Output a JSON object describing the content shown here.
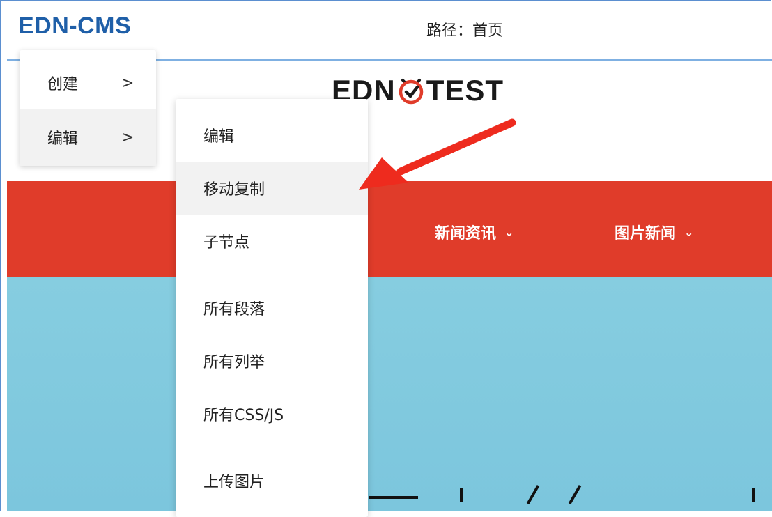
{
  "app": {
    "brand": "EDN-CMS",
    "path": "路径：首页"
  },
  "site": {
    "logo_left": "EDN",
    "logo_right": "TEST",
    "nav": [
      {
        "label": "新闻资讯",
        "chev": "⌄"
      },
      {
        "label": "图片新闻",
        "chev": "⌄"
      }
    ]
  },
  "menu_main": [
    {
      "label": "创建",
      "arrow": ">"
    },
    {
      "label": "编辑",
      "arrow": ">"
    }
  ],
  "menu_sub": [
    {
      "label": "编辑"
    },
    {
      "label": "移动复制"
    },
    {
      "label": "子节点"
    },
    {
      "label": "所有段落"
    },
    {
      "label": "所有列举"
    },
    {
      "label": "所有CSS/JS"
    },
    {
      "label": "上传图片"
    }
  ],
  "colors": {
    "brand": "#1f5fa8",
    "nav_bar": "#e03c2a",
    "hero": "#86cde0",
    "annotation_arrow": "#ee2b1e"
  },
  "icons": {
    "logo_mark": "check-circle-icon",
    "annotation": "arrow-annotation"
  }
}
